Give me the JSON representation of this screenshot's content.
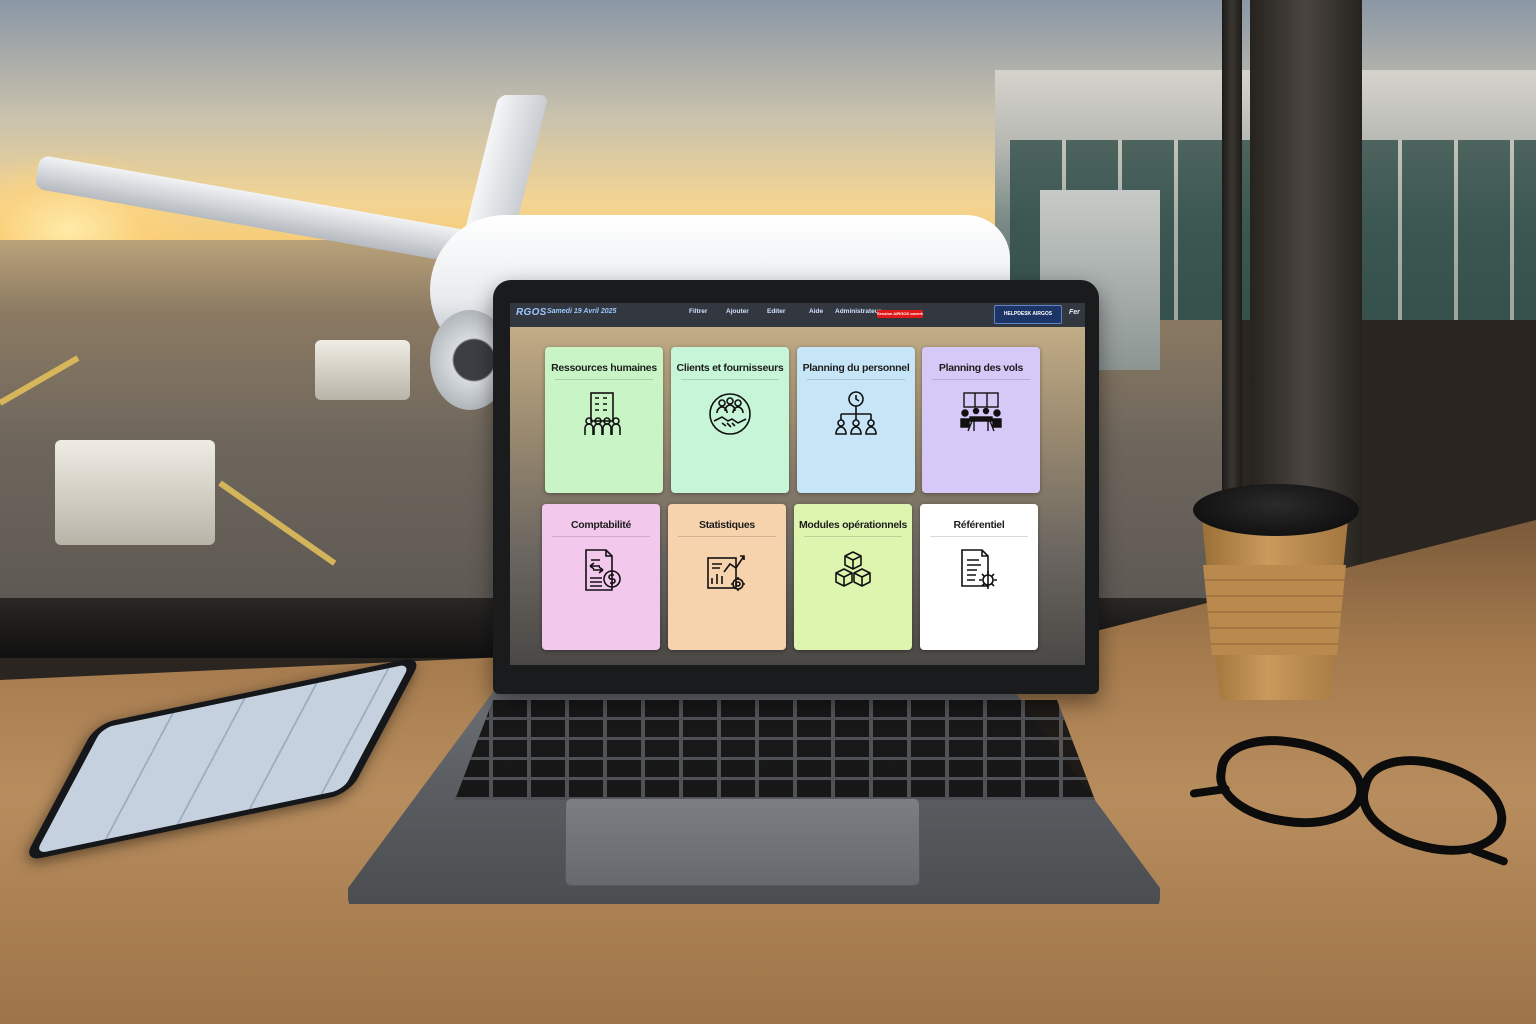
{
  "app": {
    "brand": "RGOS",
    "date": "Samedi 19 Avril 2025",
    "menu": [
      "Filtrer",
      "Ajouter",
      "Editer",
      "Aide",
      "Administrateur"
    ],
    "status_badge": "Session AIRGOS ouverte",
    "helpdesk": "HELPDESK AIRGOS",
    "right_truncated": "Fer"
  },
  "tiles": [
    {
      "title": "Ressources humaines",
      "icon": "building-people-icon",
      "color": "#c9f5c6"
    },
    {
      "title": "Clients et fournisseurs",
      "icon": "handshake-people-icon",
      "color": "#c6f5d8"
    },
    {
      "title": "Planning du personnel",
      "icon": "clock-org-chart-icon",
      "color": "#c6e6f7"
    },
    {
      "title": "Planning des vols",
      "icon": "meeting-table-icon",
      "color": "#d7c9f7"
    },
    {
      "title": "Comptabilité",
      "icon": "invoice-dollar-icon",
      "color": "#f2c9ec"
    },
    {
      "title": "Statistiques",
      "icon": "report-chart-icon",
      "color": "#f6d2ad"
    },
    {
      "title": "Modules opérationnels",
      "icon": "cubes-icon",
      "color": "#def5b0"
    },
    {
      "title": "Référentiel",
      "icon": "document-gear-icon",
      "color": "#ffffff"
    }
  ]
}
